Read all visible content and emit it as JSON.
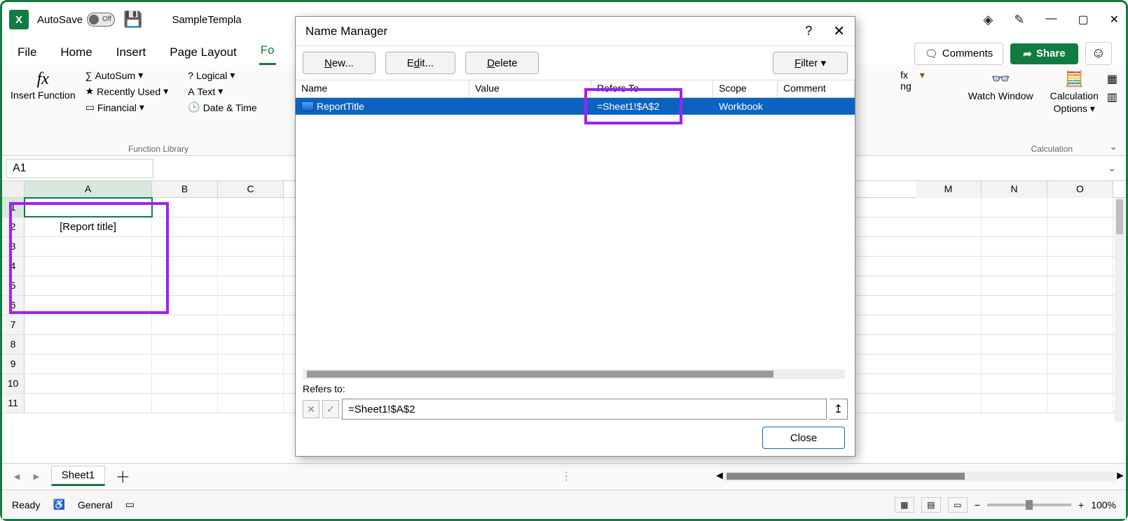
{
  "titlebar": {
    "autosave_label": "AutoSave",
    "autosave_state": "Off",
    "filename": "SampleTempla"
  },
  "tabs": {
    "file": "File",
    "home": "Home",
    "insert": "Insert",
    "page_layout": "Page Layout",
    "formulas_partial": "Fo"
  },
  "ribbon_right": {
    "comments": "Comments",
    "share": "Share"
  },
  "ribbon": {
    "insert_function": "Insert Function",
    "autosum": "AutoSum",
    "recently_used": "Recently Used",
    "financial": "Financial",
    "logical": "Logical",
    "text": "Text",
    "date_time": "Date & Time",
    "group_function_library": "Function Library",
    "watch_window": "Watch Window",
    "calc_options": "Calculation Options",
    "group_calculation": "Calculation",
    "trailing1": "ng"
  },
  "namebox": "A1",
  "columns": [
    "A",
    "B",
    "C"
  ],
  "columns_right": [
    "M",
    "N",
    "O"
  ],
  "rows": [
    "1",
    "2",
    "3",
    "4",
    "5",
    "6",
    "7",
    "8",
    "9",
    "10",
    "11"
  ],
  "cell_a2": "[Report title]",
  "sheet": {
    "active": "Sheet1"
  },
  "status": {
    "ready": "Ready",
    "access": "General",
    "zoom": "100%"
  },
  "dialog": {
    "title": "Name Manager",
    "new": "New...",
    "edit": "Edit...",
    "delete": "Delete",
    "filter": "Filter",
    "head_name": "Name",
    "head_value": "Value",
    "head_refers": "Refers To",
    "head_scope": "Scope",
    "head_comment": "Comment",
    "row": {
      "name": "ReportTitle",
      "value": "",
      "refers": "=Sheet1!$A$2",
      "scope": "Workbook",
      "comment": ""
    },
    "refers_label": "Refers to:",
    "refers_value": "=Sheet1!$A$2",
    "close": "Close"
  }
}
